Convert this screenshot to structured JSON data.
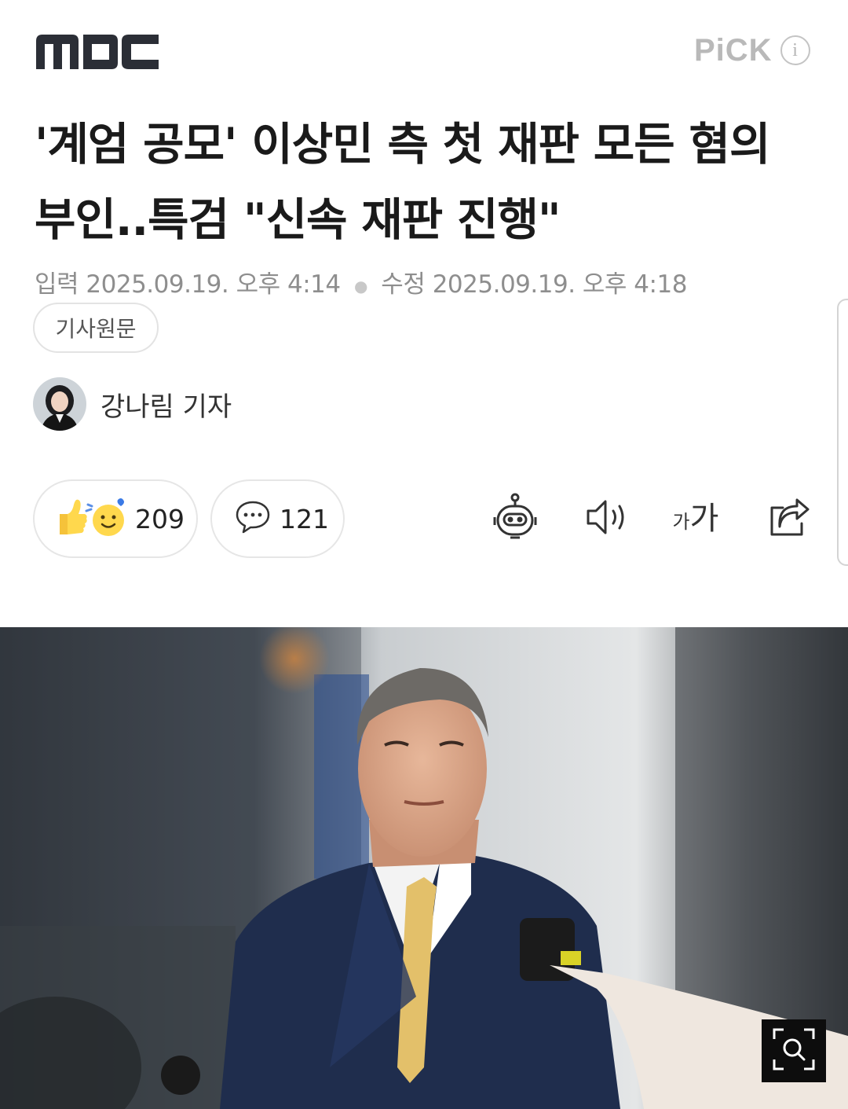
{
  "header": {
    "logo": "MBC",
    "pick_label": "PiCK",
    "info_icon": "i"
  },
  "article": {
    "title": "'계엄 공모' 이상민 측 첫 재판 모든 혐의 부인..특검 \"신속 재판 진행\"",
    "published_label": "입력",
    "published": "2025.09.19. 오후 4:14",
    "modified_label": "수정",
    "modified": "2025.09.19. 오후 4:18",
    "source_button": "기사원문",
    "author": "강나림 기자"
  },
  "actions": {
    "reactions_count": "209",
    "comments_count": "121",
    "font_size_label_small": "가",
    "font_size_label_large": "가"
  },
  "icons": {
    "reactions": "thumbs-up-smile-icon",
    "comments": "speech-bubble-icon",
    "summary_bot": "robot-icon",
    "tts": "speaker-icon",
    "font_size": "font-size-icon",
    "share": "share-icon",
    "zoom": "image-zoom-icon"
  }
}
